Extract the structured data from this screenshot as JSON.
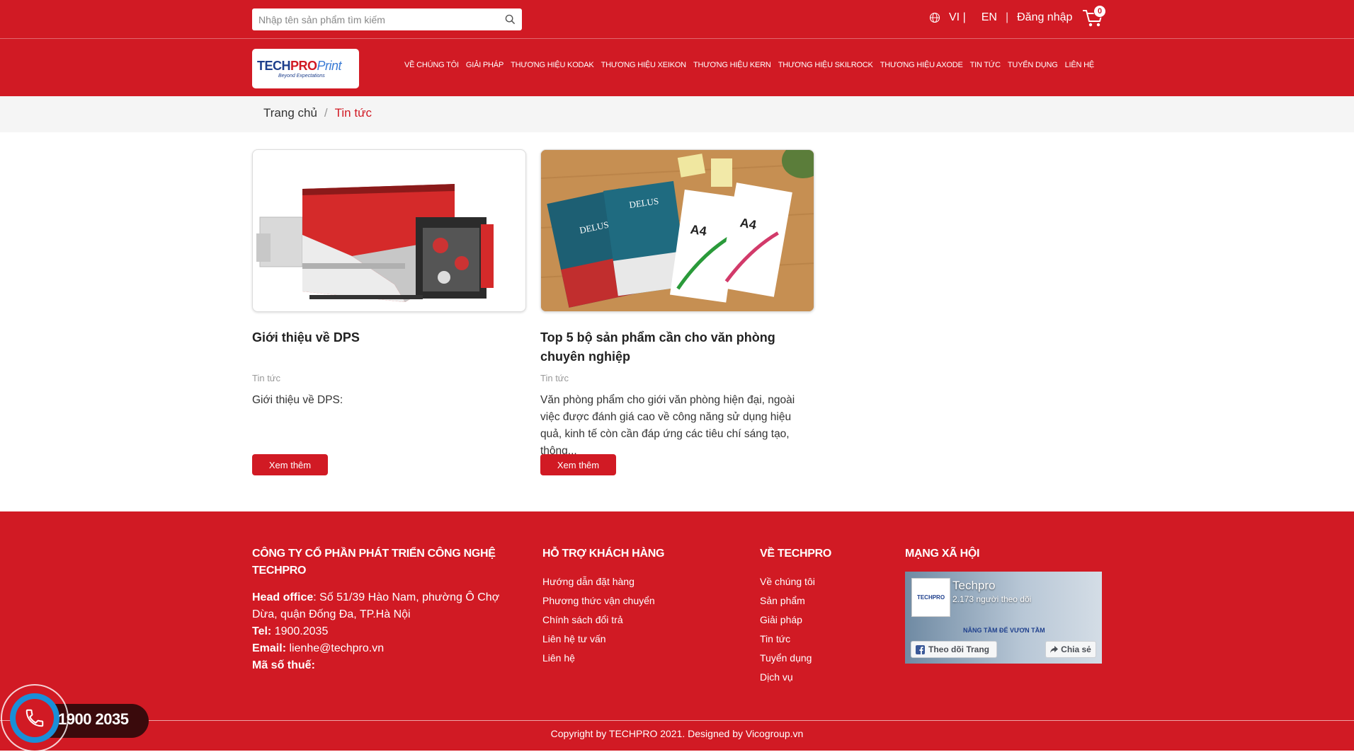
{
  "search": {
    "placeholder": "Nhập tên sản phẩm tìm kiếm"
  },
  "lang": {
    "vi": "VI |",
    "en": "EN",
    "sep": "|",
    "login": "Đăng nhập"
  },
  "cart": {
    "count": "0"
  },
  "logo": {
    "part1": "TECH",
    "part2": "PRO",
    "part3": "Print",
    "tagline": "Beyond Expectations"
  },
  "nav": [
    "VỀ CHÚNG TÔI",
    "GIẢI PHÁP",
    "THƯƠNG HIỆU KODAK",
    "THƯƠNG HIỆU XEIKON",
    "THƯƠNG HIỆU KERN",
    "THƯƠNG HIỆU SKILROCK",
    "THƯƠNG HIỆU AXODE",
    "TIN TỨC",
    "TUYỂN DỤNG",
    "LIÊN HỆ"
  ],
  "breadcrumb": {
    "home": "Trang chủ",
    "sep": "/",
    "current": "Tin tức"
  },
  "posts": [
    {
      "title": "Giới thiệu về DPS",
      "category": "Tin tức",
      "excerpt": "Giới thiệu về DPS:",
      "button": "Xem thêm"
    },
    {
      "title": "Top 5 bộ sản phẩm cần cho văn phòng chuyên nghiệp",
      "category": "Tin tức",
      "excerpt": "Văn phòng phẩm cho giới văn phòng hiện đại, ngoài việc được đánh giá cao về công năng sử dụng hiệu quả, kinh tế còn cần đáp ứng các tiêu chí sáng tạo, thông...",
      "button": "Xem thêm",
      "image_text": {
        "paper1": "DELUS",
        "paper2": "DELUS",
        "paper3": "A4",
        "paper4": "A4"
      }
    }
  ],
  "footer": {
    "company": {
      "heading": "CÔNG TY CỔ PHẦN PHÁT TRIỂN CÔNG NGHỆ TECHPRO",
      "office_label": "Head office",
      "office": ": Số 51/39 Hào Nam, phường Ô Chợ Dừa, quận Đống Đa, TP.Hà Nội",
      "tel_label": "Tel:",
      "tel": " 1900.2035",
      "email_label": "Email:",
      "email": " lienhe@techpro.vn",
      "tax_label": "Mã số thuế:"
    },
    "support": {
      "heading": "HỖ TRỢ KHÁCH HÀNG",
      "links": [
        "Hướng dẫn đặt hàng",
        "Phương thức vận chuyển",
        "Chính sách đổi trả",
        "Liên hệ tư vấn",
        "Liên hệ"
      ]
    },
    "about": {
      "heading": "VỀ TECHPRO",
      "links": [
        "Về chúng tôi",
        "Sản phẩm",
        "Giải pháp",
        "Tin tức",
        "Tuyển dụng",
        "Dịch vụ"
      ]
    },
    "social": {
      "heading": "MẠNG XÃ HỘI",
      "page_name": "Techpro",
      "followers": "2.173 người theo dõi",
      "pic_text": "TECHPRO",
      "slogan": "NÂNG TẦM ĐỂ VƯƠN TẦM",
      "follow_btn": "Theo dõi Trang",
      "share_btn": "Chia sẻ"
    },
    "copyright": "Copyright by TECHPRO 2021. Designed by Vicogroup.vn"
  },
  "hotline": {
    "number": "1900 2035"
  },
  "colors": {
    "brand": "#d11a24",
    "accent_blue": "#1a8fd8"
  }
}
